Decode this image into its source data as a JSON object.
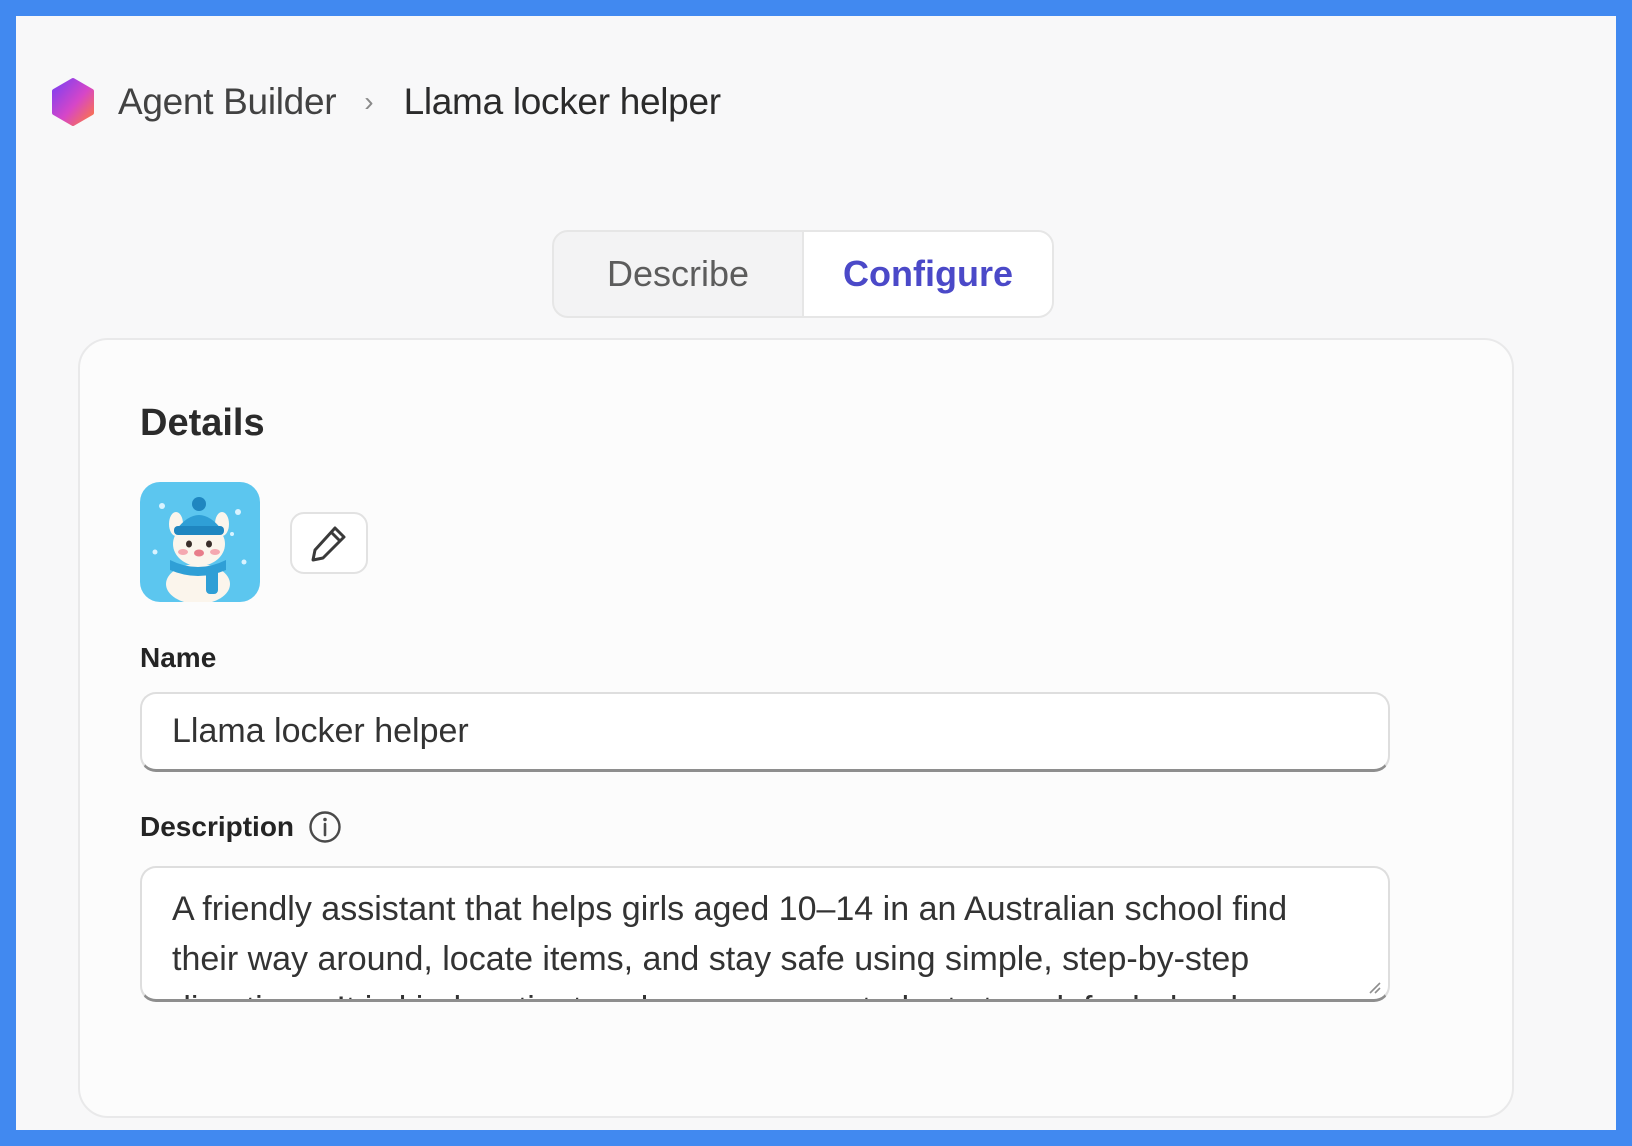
{
  "breadcrumb": {
    "app_name": "Agent Builder",
    "separator": "›",
    "current": "Llama locker helper"
  },
  "tabs": [
    {
      "label": "Describe",
      "active": false
    },
    {
      "label": "Configure",
      "active": true
    }
  ],
  "details": {
    "title": "Details",
    "name_label": "Name",
    "name_value": "Llama locker helper",
    "description_label": "Description",
    "description_value": "A friendly assistant that helps girls aged 10–14 in an Australian school find their way around, locate items, and stay safe using simple, step-by-step directions. It is kind, patient and encourages students to ask for help when needed."
  },
  "icons": {
    "logo": "agent-builder-logo",
    "edit": "pencil-icon",
    "info": "info-icon"
  },
  "colors": {
    "frame_border": "#4189f0",
    "active_tab": "#4b49c8",
    "avatar_bg": "#5cc6ef"
  }
}
